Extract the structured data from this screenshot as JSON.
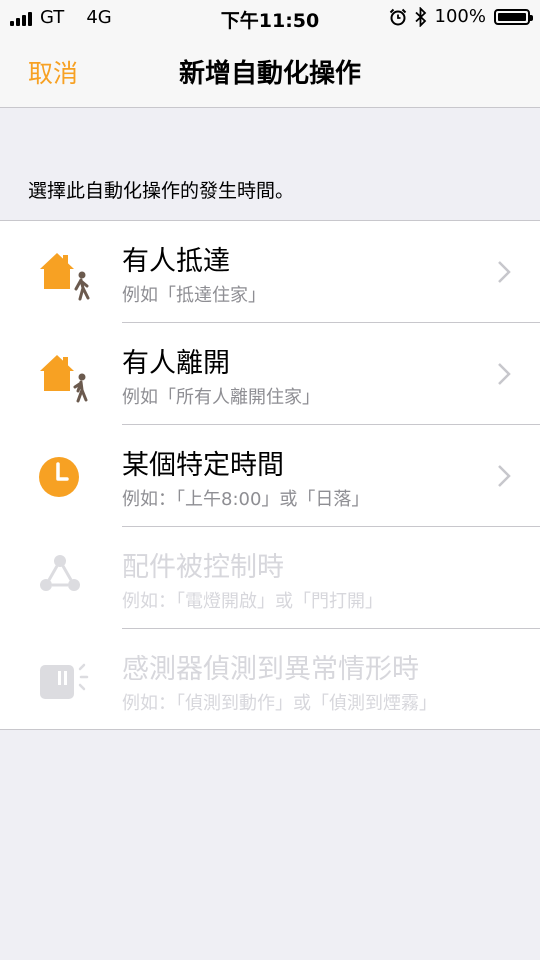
{
  "status_bar": {
    "carrier": "GT",
    "network": "4G",
    "time": "下午11:50",
    "battery": "100%",
    "icons": [
      "signal-icon",
      "alarm-icon",
      "bluetooth-icon",
      "battery-icon"
    ]
  },
  "nav": {
    "cancel_label": "取消",
    "title": "新增自動化操作"
  },
  "section": {
    "header": "選擇此自動化操作的發生時間。"
  },
  "items": [
    {
      "title": "有人抵達",
      "subtitle": "例如「抵達住家」",
      "icon": "person-arrive-home-icon",
      "enabled": true
    },
    {
      "title": "有人離開",
      "subtitle": "例如「所有人離開住家」",
      "icon": "person-leave-home-icon",
      "enabled": true
    },
    {
      "title": "某個特定時間",
      "subtitle": "例如：「上午8:00」或「日落」",
      "icon": "clock-icon",
      "enabled": true
    },
    {
      "title": "配件被控制時",
      "subtitle": "例如：「電燈開啟」或「門打開」",
      "icon": "accessory-icon",
      "enabled": false
    },
    {
      "title": "感測器偵測到異常情形時",
      "subtitle": "例如：「偵測到動作」或「偵測到煙霧」",
      "icon": "sensor-icon",
      "enabled": false
    }
  ],
  "colors": {
    "accent": "#f7a123",
    "disabled": "#d7d7dc",
    "background": "#efeff4"
  }
}
